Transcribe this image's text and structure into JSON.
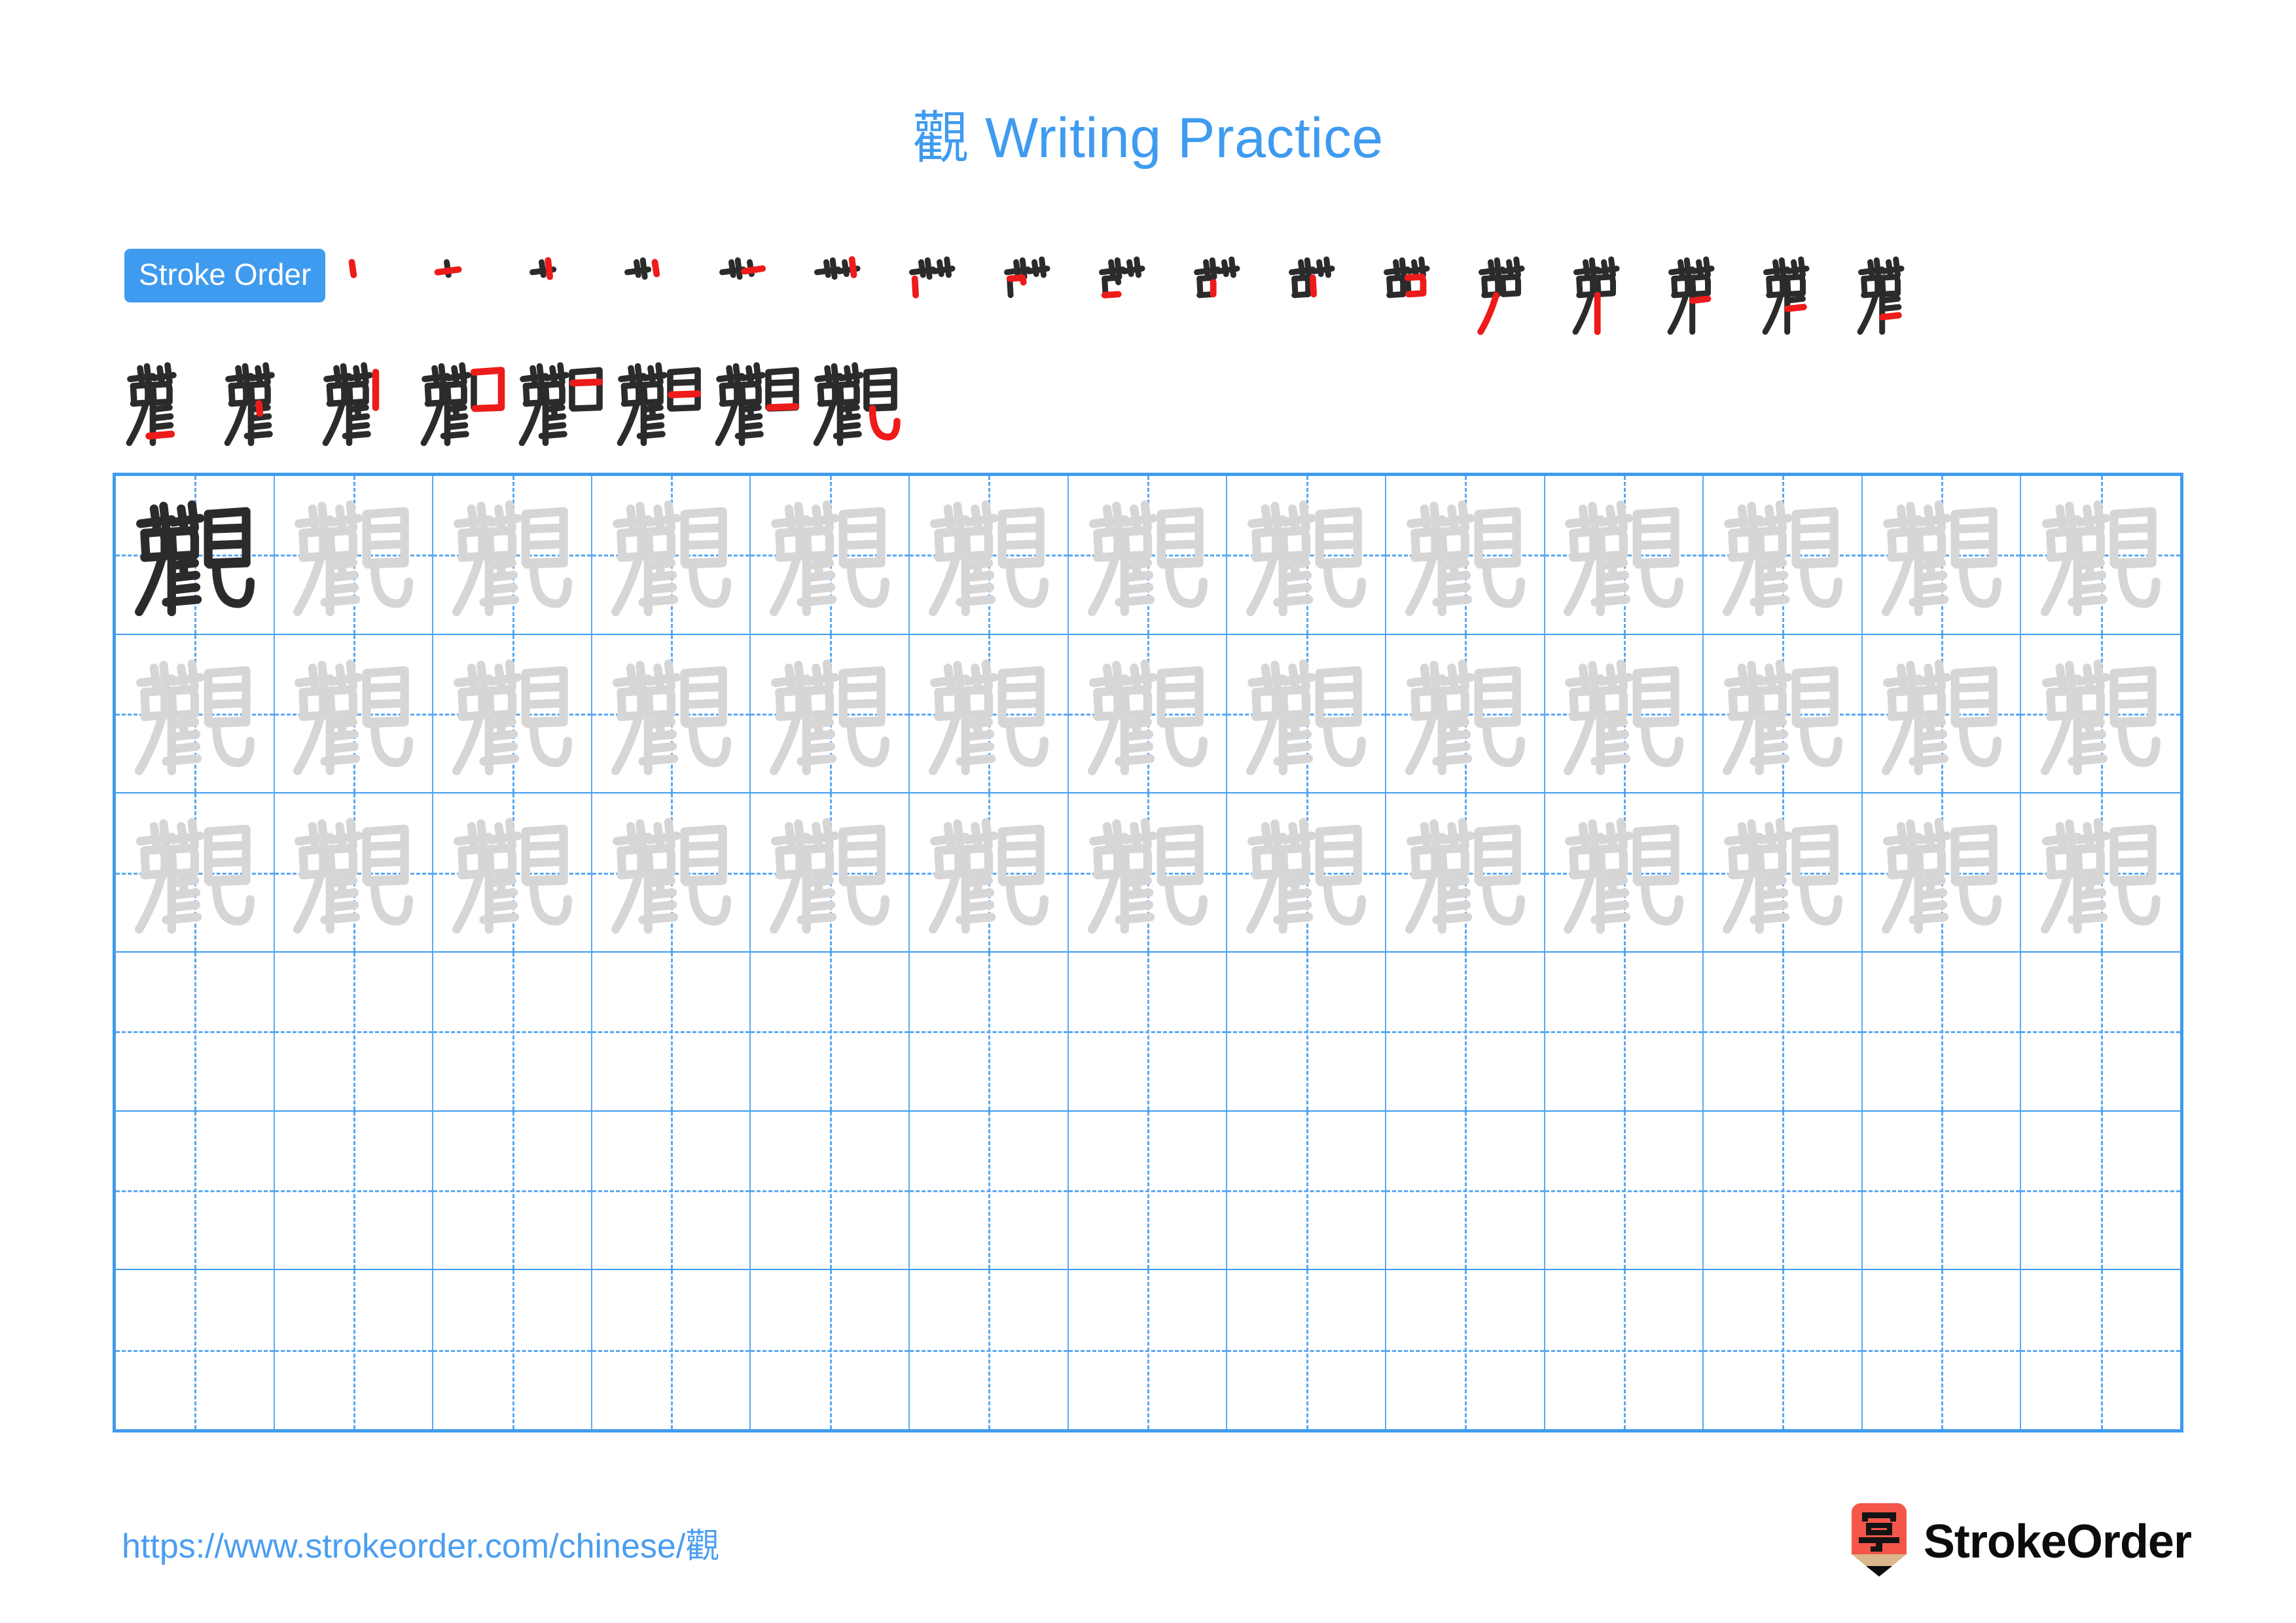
{
  "page": {
    "character": "觀",
    "title_suffix": " Writing Practice",
    "background_color": "#ffffff"
  },
  "colors": {
    "accent_blue": "#3f9bef",
    "grid_line": "#3f9bef",
    "grid_guide": "#5aa9f2",
    "stroke_new_red": "#ee1b1b",
    "stroke_done_black": "#2b2b2b",
    "trace_gray": "#d6d6d6",
    "model_dark": "#2b2b2b",
    "logo_red": "#f4564a",
    "logo_wood": "#dcb68c",
    "logo_text": "#0c0c0c"
  },
  "header": {
    "title_character": "觀",
    "title_text": "Writing Practice"
  },
  "stroke_order": {
    "badge_label": "Stroke Order",
    "total_strokes": 25,
    "row_1_count": 17,
    "row_2_count": 8,
    "description": "Progressive stroke-by-stroke build-up of 觀; the newest stroke of each step is drawn in red, previously drawn strokes in black."
  },
  "practice_grid": {
    "columns": 13,
    "rows": 6,
    "model_cell": {
      "row": 1,
      "column": 1,
      "character": "觀",
      "style": "dark"
    },
    "trace_rows": [
      1,
      2,
      3
    ],
    "blank_rows": [
      4,
      5,
      6
    ],
    "trace_character": "觀",
    "guide_style": "dashed-crosshair"
  },
  "footer": {
    "url": "https://www.strokeorder.com/chinese/觀",
    "brand_name": "StrokeOrder",
    "logo_character": "字"
  }
}
